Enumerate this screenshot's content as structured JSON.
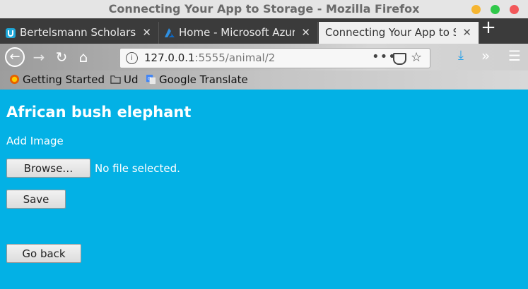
{
  "window": {
    "title": "Connecting Your App to Storage - Mozilla Firefox",
    "controls": [
      {
        "name": "minimize",
        "color": "#f5b531"
      },
      {
        "name": "maximize",
        "color": "#30c84a"
      },
      {
        "name": "close",
        "color": "#f2585a"
      }
    ]
  },
  "tabs": [
    {
      "label": "Bertelsmann Scholarsh",
      "icon": "udacity-icon",
      "active": false
    },
    {
      "label": "Home - Microsoft Azur",
      "icon": "azure-icon",
      "active": false
    },
    {
      "label": "Connecting Your App to St",
      "icon": "",
      "active": true
    }
  ],
  "newtab_label": "+",
  "nav": {
    "url_host": "127.0.0.1",
    "url_rest": ":5555/animal/2",
    "dots": "•••"
  },
  "bookmarks": [
    {
      "label": "Getting Started",
      "icon": "firefox-icon"
    },
    {
      "label": "Ud",
      "icon": "folder-icon"
    },
    {
      "label": "Google Translate",
      "icon": "google-translate-icon"
    }
  ],
  "page": {
    "heading": "African bush elephant",
    "add_image_label": "Add Image",
    "browse_label": "Browse…",
    "no_file_text": "No file selected.",
    "save_label": "Save",
    "go_back_label": "Go back"
  },
  "colors": {
    "page_bg": "#03b1e5",
    "tabbar_bg": "#3b3b3b",
    "accent_download": "#2ea3e8"
  }
}
